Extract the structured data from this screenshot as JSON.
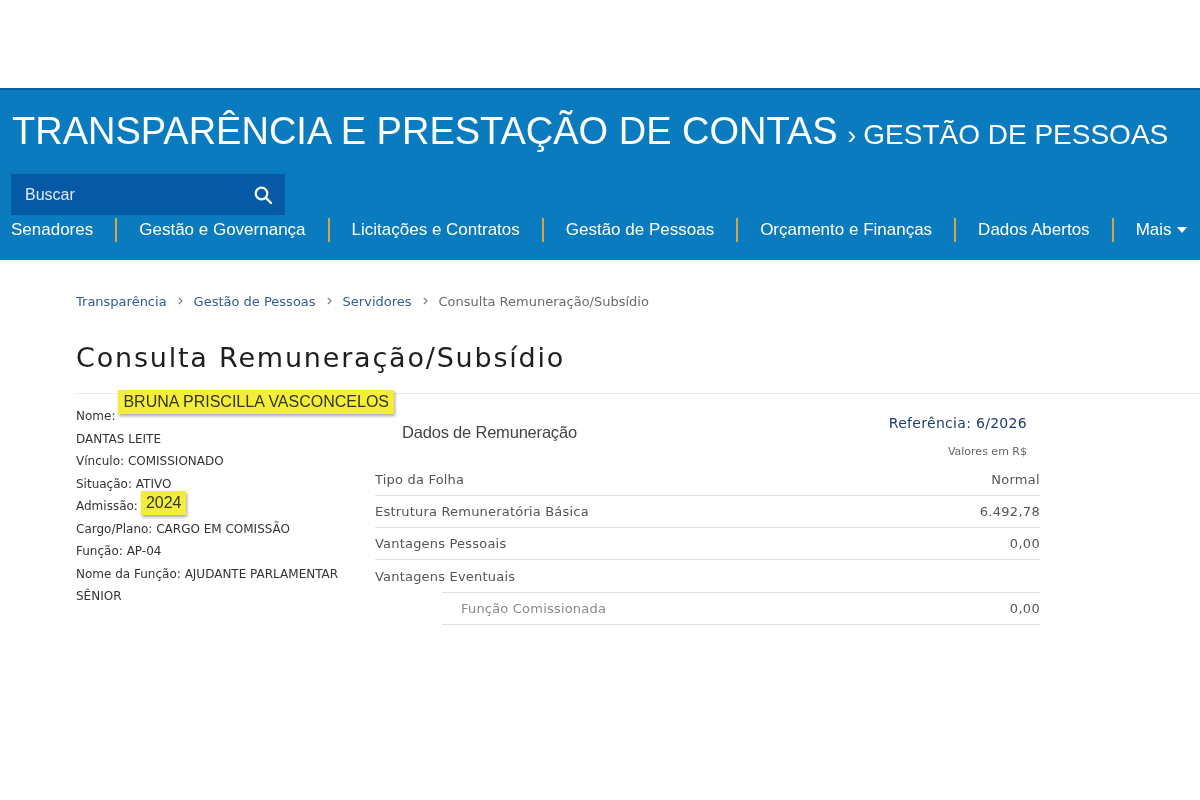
{
  "header": {
    "title": "TRANSPARÊNCIA E PRESTAÇÃO DE CONTAS",
    "separator": "›",
    "section": "GESTÃO DE PESSOAS"
  },
  "search": {
    "placeholder": "Buscar"
  },
  "nav": [
    {
      "label": "Senadores",
      "has_menu": false
    },
    {
      "label": "Gestão e Governança",
      "has_menu": false
    },
    {
      "label": "Licitações e Contratos",
      "has_menu": false
    },
    {
      "label": "Gestão de Pessoas",
      "has_menu": false
    },
    {
      "label": "Orçamento e Finanças",
      "has_menu": false
    },
    {
      "label": "Dados Abertos",
      "has_menu": false
    },
    {
      "label": "Mais",
      "has_menu": true
    }
  ],
  "breadcrumb": [
    {
      "label": "Transparência",
      "current": false
    },
    {
      "label": "Gestão de Pessoas",
      "current": false
    },
    {
      "label": "Servidores",
      "current": false
    },
    {
      "label": "Consulta Remuneração/Subsídio",
      "current": true
    }
  ],
  "page_title": "Consulta Remuneração/Subsídio",
  "employee": [
    {
      "label": "Nome:",
      "highlight": "BRUNA PRISCILLA VASCONCELOS",
      "value": "DANTAS LEITE"
    },
    {
      "label": "Vínculo:",
      "value": "COMISSIONADO"
    },
    {
      "label": "Situação:",
      "value": "ATIVO"
    },
    {
      "label": "Admissão:",
      "highlight": "2024"
    },
    {
      "label": "Cargo/Plano:",
      "value": "CARGO EM COMISSÃO"
    },
    {
      "label": "Função:",
      "value": "AP-04"
    },
    {
      "label": "Nome da Função:",
      "value": "AJUDANTE PARLAMENTAR SÊNIOR"
    }
  ],
  "remuneration": {
    "title": "Dados de Remuneração",
    "reference": "Referência: 6/2026",
    "currency_note": "Valores em R$",
    "rows": [
      {
        "label": "Tipo da Folha",
        "value": "Normal"
      },
      {
        "label": "Estrutura Remuneratória Básica",
        "value": "6.492,78"
      },
      {
        "label": "Vantagens Pessoais",
        "value": "0,00"
      },
      {
        "label": "Vantagens Eventuais",
        "children": [
          {
            "label": "Função Comissionada",
            "value": "0,00"
          }
        ]
      }
    ]
  }
}
